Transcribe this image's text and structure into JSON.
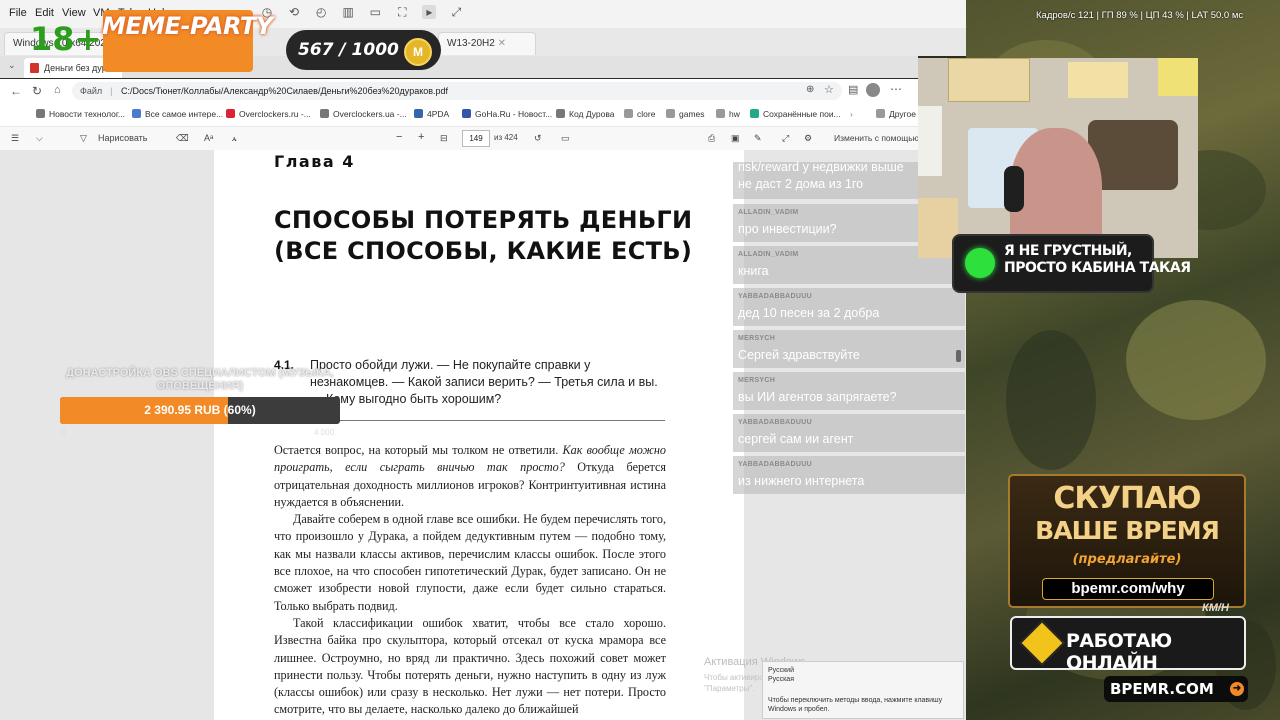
{
  "vm_menu": {
    "file": "File",
    "edit": "Edit",
    "view": "View",
    "vm": "VM",
    "tabs": "Tabs",
    "help": "Help"
  },
  "vm_tabs": [
    {
      "label": "Windows 10 x64 2026"
    },
    {
      "label": "W13-20H2"
    }
  ],
  "edge_tab": {
    "label": "Деньги без дураков"
  },
  "address": {
    "prefix": "Файл",
    "url": "C:/Docs/Тюнет/Коллабы/Александр%20Силаев/Деньги%20без%20дураков.pdf"
  },
  "bookmarks": [
    {
      "label": "Новости технолог..."
    },
    {
      "label": "Все самое интере..."
    },
    {
      "label": "Overclockers.ru -..."
    },
    {
      "label": "Overclockers.ua -..."
    },
    {
      "label": "4PDA"
    },
    {
      "label": "GoHa.Ru - Новост..."
    },
    {
      "label": "Код Дурова"
    },
    {
      "label": "clore"
    },
    {
      "label": "games"
    },
    {
      "label": "hw"
    },
    {
      "label": "Сохранённые пои..."
    },
    {
      "label": "Другое"
    }
  ],
  "pdf_toolbar": {
    "draw": "Нарисовать",
    "page": "149",
    "of_pages": "из 424",
    "edit_with": "Изменить с помощью"
  },
  "pdf": {
    "chapter": "Глава 4",
    "title": "СПОСОБЫ ПОТЕРЯТЬ ДЕНЬГИ (ВСЕ СПОСОБЫ, КАКИЕ ЕСТЬ)",
    "section_num": "4.1.",
    "section_text": "Просто обойди лужи. — Не покупайте справки у незнакомцев. — Какой записи верить? — Третья сила и вы. — Кому выгодно быть хорошим?",
    "p1_a": "Остается вопрос, на который мы толком не ответили. ",
    "p1_i": "Как вообще можно проиграть, если сыграть вничью так просто?",
    "p1_b": " Откуда берется отрицательная доходность миллионов игроков? Контринтуитивная истина нуждается в объяснении.",
    "p2": "Давайте соберем в одной главе все ошибки. Не будем перечислять того, что произошло у Дурака, а пойдем дедуктивным путем — подобно тому, как мы назвали классы активов, перечислим классы ошибок. После этого все плохое, на что способен гипотетический Дурак, будет записано. Он не сможет изобрести новой глупости, даже если будет сильно стараться. Только выбрать подвид.",
    "p3": "Такой классификации ошибок хватит, чтобы все стало хорошо. Известна байка про скульптора, который отсекал от куска мрамора все лишнее. Остроумно, но вряд ли практично. Здесь похожий совет может принести пользу. Чтобы потерять деньги, нужно наступить в одну из луж (классы ошибок) или сразу в несколько. Нет лужи — нет потери. Просто смотрите, что вы делаете, насколько далеко до ближайшей"
  },
  "chat": [
    {
      "user": "",
      "text": "не даст 2 дома из 1го",
      "top_line": "risk/reward у недвижки выше"
    },
    {
      "user": "ALLADIN_VADIM",
      "text": "про инвестиции?"
    },
    {
      "user": "ALLADIN_VADIM",
      "text": "книга"
    },
    {
      "user": "YABBADABBADUUU",
      "text": "дед 10 песен за 2 добра"
    },
    {
      "user": "MERSYCH",
      "text": "Сергей здравствуйте"
    },
    {
      "user": "MERSYCH",
      "text": "вы ИИ агентов запрягаете?"
    },
    {
      "user": "YABBADABBADUUU",
      "text": "сергей сам ии агент"
    },
    {
      "user": "YABBADABBADUUU",
      "text": "из нижнего интернета"
    }
  ],
  "windows": {
    "activate_title": "Активация Windows",
    "activate_sub": "Чтобы активировать Windows, перейдите в раздел \"Параметры\".",
    "lang_1": "Русский",
    "lang_2": "Русская",
    "lang_hint": "Чтобы переключить методы ввода, нажмите клавишу Windows и пробел."
  },
  "overlay": {
    "age": "18+",
    "party": "MEME-PARTY",
    "score": "567 / 1000",
    "coin": "M",
    "donate_title": "ДОНАСТРОЙКА OBS СПЕЦИАЛИСТОМ (МУЗЫКА, ОПОВЕЩЕНИЯ)",
    "donate_amount": "2 390.95 RUB (60%)",
    "donate_fraction": 0.6,
    "donate_min": "0",
    "donate_max": "4 000",
    "stats": "Кадров/с  121  |  ГП  89 %  |  ЦП  43 %  |  LAT  50.0 мс",
    "sad_line1": "Я НЕ ГРУСТНЫЙ,",
    "sad_line2": "ПРОСТО КАБИНА ТАКАЯ",
    "ad1_line1": "СКУПАЮ",
    "ad1_line2": "ВАШЕ ВРЕМЯ",
    "ad1_line3": "(предлагайте)",
    "ad1_url": "bpemr.com/why",
    "ad2": "РАБОТАЮ ОНЛАЙН",
    "ad3": "BPEMR.COM",
    "kmn": "КМ/Н"
  },
  "colors": {
    "accent_orange": "#f28a25",
    "age_green": "#2b9f1c",
    "status_green": "#2de03b"
  }
}
